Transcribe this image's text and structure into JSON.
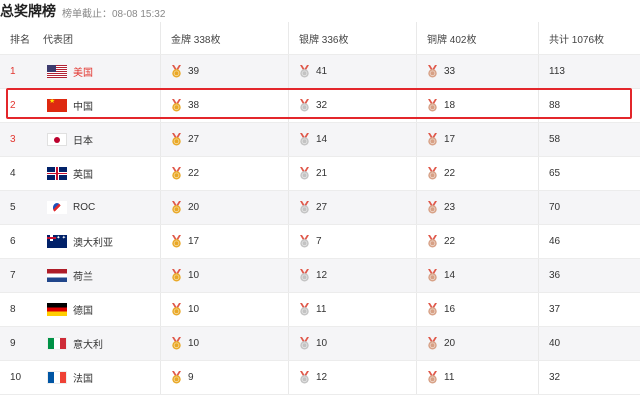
{
  "header": {
    "title": "总奖牌榜",
    "deadline": "榜单截止：08-08 15:32"
  },
  "columns": {
    "rank": "排名",
    "team": "代表团",
    "gold": "金牌 338枚",
    "silver": "银牌 336枚",
    "bronze": "铜牌 402枚",
    "total": "共计 1076枚"
  },
  "colors": {
    "accent_red": "#e2352f",
    "highlight_border": "#e3262b",
    "gold_medal": "#e9a825",
    "silver_medal": "#c3c3c3",
    "bronze_medal": "#d7a085",
    "ribbon": "#e0584a"
  },
  "rows": [
    {
      "rank": "1",
      "team": "美国",
      "flag": "us-flag",
      "gold": "39",
      "silver": "41",
      "bronze": "33",
      "total": "113"
    },
    {
      "rank": "2",
      "team": "中国",
      "flag": "cn-flag",
      "gold": "38",
      "silver": "32",
      "bronze": "18",
      "total": "88"
    },
    {
      "rank": "3",
      "team": "日本",
      "flag": "jp-flag",
      "gold": "27",
      "silver": "14",
      "bronze": "17",
      "total": "58"
    },
    {
      "rank": "4",
      "team": "英国",
      "flag": "gb-flag",
      "gold": "22",
      "silver": "21",
      "bronze": "22",
      "total": "65"
    },
    {
      "rank": "5",
      "team": "ROC",
      "flag": "roc-flag",
      "gold": "20",
      "silver": "27",
      "bronze": "23",
      "total": "70"
    },
    {
      "rank": "6",
      "team": "澳大利亚",
      "flag": "au-flag",
      "gold": "17",
      "silver": "7",
      "bronze": "22",
      "total": "46"
    },
    {
      "rank": "7",
      "team": "荷兰",
      "flag": "nl-flag",
      "gold": "10",
      "silver": "12",
      "bronze": "14",
      "total": "36"
    },
    {
      "rank": "8",
      "team": "德国",
      "flag": "de-flag",
      "gold": "10",
      "silver": "11",
      "bronze": "16",
      "total": "37"
    },
    {
      "rank": "9",
      "team": "意大利",
      "flag": "it-flag",
      "gold": "10",
      "silver": "10",
      "bronze": "20",
      "total": "40"
    },
    {
      "rank": "10",
      "team": "法国",
      "flag": "fr-flag",
      "gold": "9",
      "silver": "12",
      "bronze": "11",
      "total": "32"
    }
  ]
}
